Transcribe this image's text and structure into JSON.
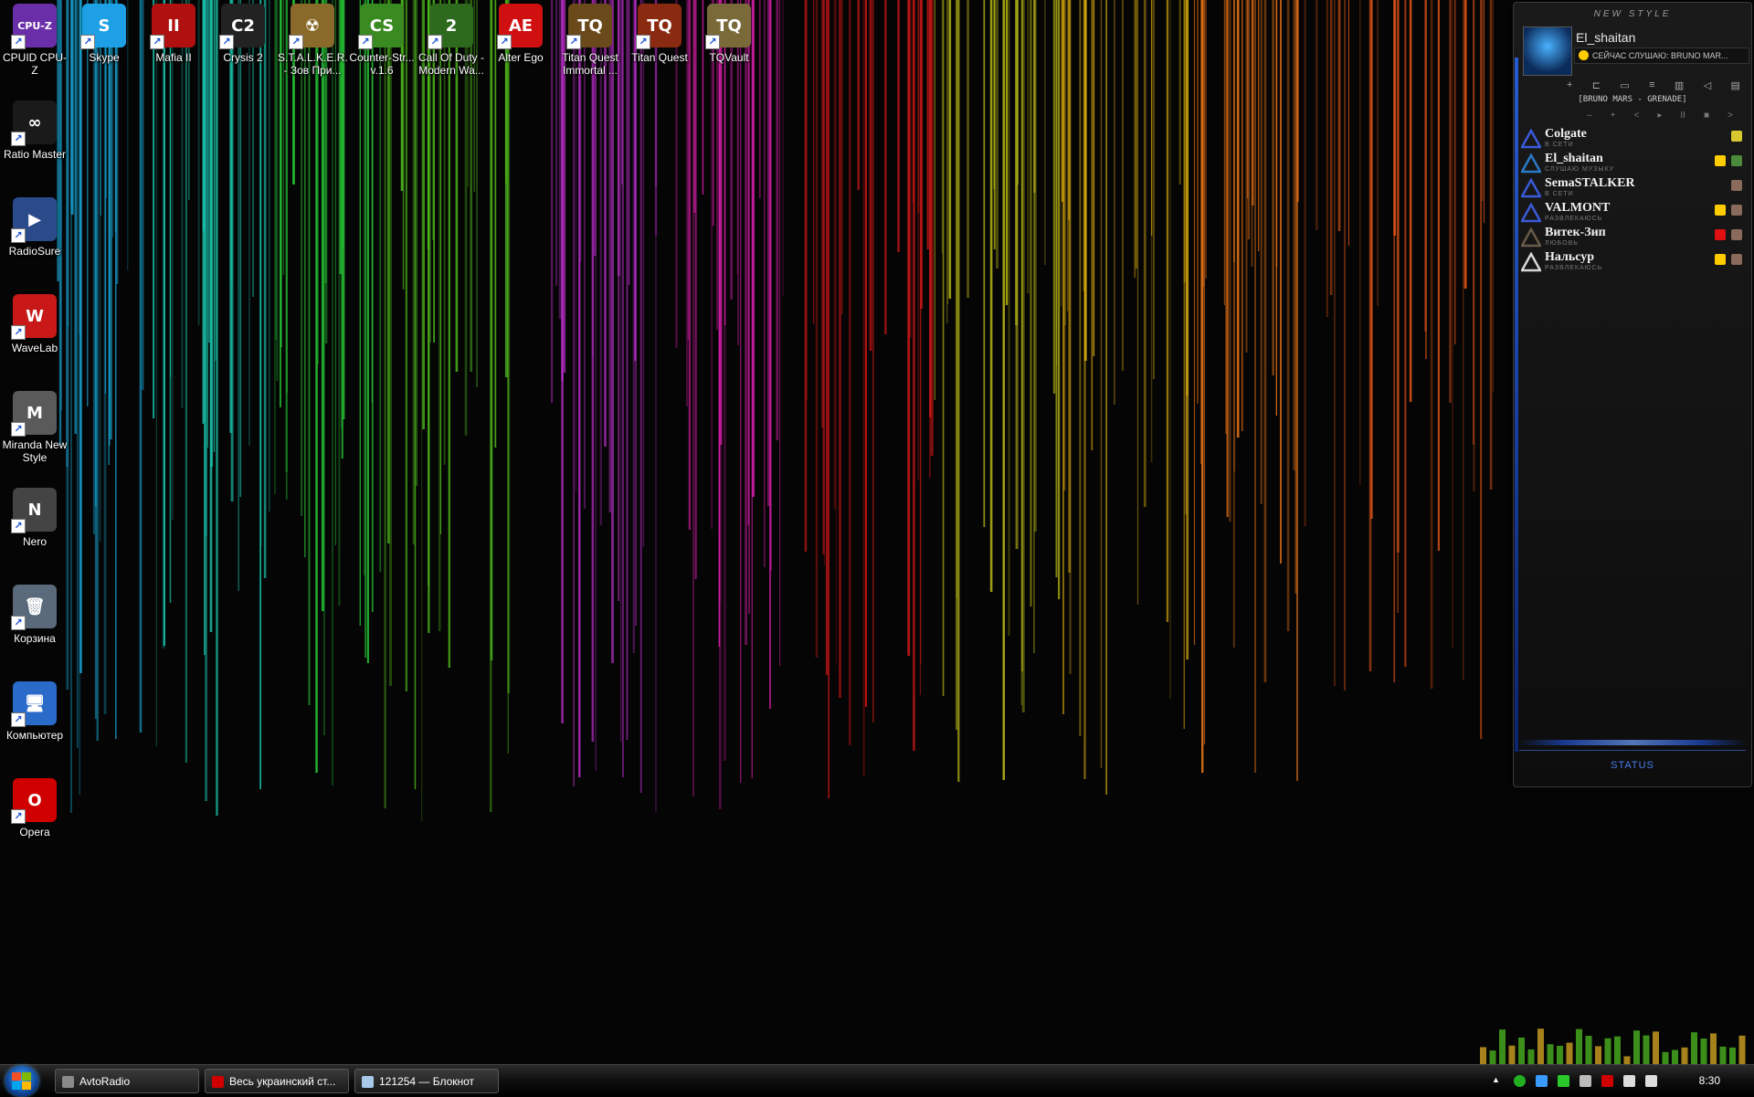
{
  "desktop_icons": [
    {
      "label": "CPUID CPU-Z",
      "icon": "cpuz-icon",
      "color": "#6a2fa8",
      "glyph": "CPU-Z"
    },
    {
      "label": "Skype",
      "icon": "skype-icon",
      "color": "#1ea0e6",
      "glyph": "S"
    },
    {
      "label": "Mafia II",
      "icon": "mafia-icon",
      "color": "#b01010",
      "glyph": "II"
    },
    {
      "label": "Crysis 2",
      "icon": "crysis-icon",
      "color": "#222222",
      "glyph": "C2"
    },
    {
      "label": "S.T.A.L.K.E.R. - Зов При...",
      "icon": "radiation-icon",
      "color": "#8a6a2a",
      "glyph": "☢"
    },
    {
      "label": "Counter-Str... v.1.6",
      "icon": "counter-strike-icon",
      "color": "#3a8a22",
      "glyph": "CS"
    },
    {
      "label": "Call Of Duty - Modern Wa...",
      "icon": "call-of-duty-icon",
      "color": "#2d6a1d",
      "glyph": "2"
    },
    {
      "label": "Alter Ego",
      "icon": "alter-ego-icon",
      "color": "#d01010",
      "glyph": "AE"
    },
    {
      "label": "Titan Quest Immortal ...",
      "icon": "titan-quest-immortal-icon",
      "color": "#6a4a1a",
      "glyph": "TQ"
    },
    {
      "label": "Titan Quest",
      "icon": "titan-quest-icon",
      "color": "#8a2a10",
      "glyph": "TQ"
    },
    {
      "label": "TQVault",
      "icon": "tqvault-icon",
      "color": "#7a6a3a",
      "glyph": "TQ"
    },
    {
      "label": "Ratio Master",
      "icon": "ratio-master-icon",
      "color": "#1a1a1a",
      "glyph": "∞"
    },
    {
      "label": "RadioSure",
      "icon": "radiosure-icon",
      "color": "#2a4a8a",
      "glyph": "▶"
    },
    {
      "label": "WaveLab",
      "icon": "wavelab-icon",
      "color": "#c81818",
      "glyph": "W"
    },
    {
      "label": "Miranda New Style",
      "icon": "miranda-icon",
      "color": "#5a5a5a",
      "glyph": "M"
    },
    {
      "label": "Nero",
      "icon": "nero-icon",
      "color": "#444444",
      "glyph": "N"
    },
    {
      "label": "Корзина",
      "icon": "recycle-bin-icon",
      "color": "#5a6a7a",
      "glyph": "🗑"
    },
    {
      "label": "Компьютер",
      "icon": "computer-icon",
      "color": "#2a6ac8",
      "glyph": "🖥"
    },
    {
      "label": "Opera",
      "icon": "opera-icon",
      "color": "#d00000",
      "glyph": "O"
    }
  ],
  "miranda": {
    "title": "NEW STYLE",
    "nick": "El_shaitan",
    "now_playing": "СЕЙЧАС СЛУШАЮ: BRUNO MAR...",
    "toolbar": [
      "+",
      "⊏",
      "▭",
      "≡",
      "▥",
      "◁",
      "▤"
    ],
    "song": "[BRUNO MARS - GRENADE]",
    "player": [
      "–",
      "+",
      "<",
      "▸",
      "II",
      "■",
      ">"
    ],
    "contacts": [
      {
        "name": "Colgate",
        "status": "В СЕТИ",
        "icon_color": "#3a5ad8",
        "extra": [
          "#d8c830"
        ]
      },
      {
        "name": "El_shaitan",
        "status": "СЛУШАЮ МУЗЫКУ",
        "icon_color": "#2a7ac8",
        "extra": [
          "#ffcc00",
          "#4a8a3a"
        ]
      },
      {
        "name": "SemaSTALKER",
        "status": "В СЕТИ",
        "icon_color": "#3a5ad8",
        "extra": [
          "#8a6a5a"
        ]
      },
      {
        "name": "VALMONT",
        "status": "РАЗВЛЕКАЮСЬ",
        "icon_color": "#3a5ad8",
        "extra": [
          "#ffcc00",
          "#8a6a5a"
        ]
      },
      {
        "name": "Витек-Зип",
        "status": "ЛЮБОВЬ",
        "icon_color": "#6a5a4a",
        "extra": [
          "#e01010",
          "#8a6a5a"
        ]
      },
      {
        "name": "Нальсур",
        "status": "РАЗВЛЕКАЮСЬ",
        "icon_color": "#d8d8d8",
        "extra": [
          "#ffcc00",
          "#8a6a5a"
        ]
      }
    ],
    "status_button": "STATUS"
  },
  "taskbar": {
    "tasks": [
      {
        "label": "AvtoRadio",
        "icon": "avtoradio-icon",
        "color": "#8a8a8a"
      },
      {
        "label": "Весь украинский ст...",
        "icon": "opera-icon",
        "color": "#d00000"
      },
      {
        "label": "121254 — Блокнот",
        "icon": "notepad-icon",
        "color": "#a8c8e8"
      }
    ],
    "tray": [
      {
        "icon": "show-hidden-icon",
        "color": "#ffffff"
      },
      {
        "icon": "green-status-icon",
        "color": "#22b022"
      },
      {
        "icon": "download-icon",
        "color": "#3a9aff"
      },
      {
        "icon": "app-green-icon",
        "color": "#2ac82a"
      },
      {
        "icon": "usb-icon",
        "color": "#bbbbbb"
      },
      {
        "icon": "language-flag-icon",
        "color": "#d00000"
      },
      {
        "icon": "network-icon",
        "color": "#dddddd"
      },
      {
        "icon": "volume-icon",
        "color": "#dddddd"
      }
    ],
    "clock": "8:30"
  }
}
